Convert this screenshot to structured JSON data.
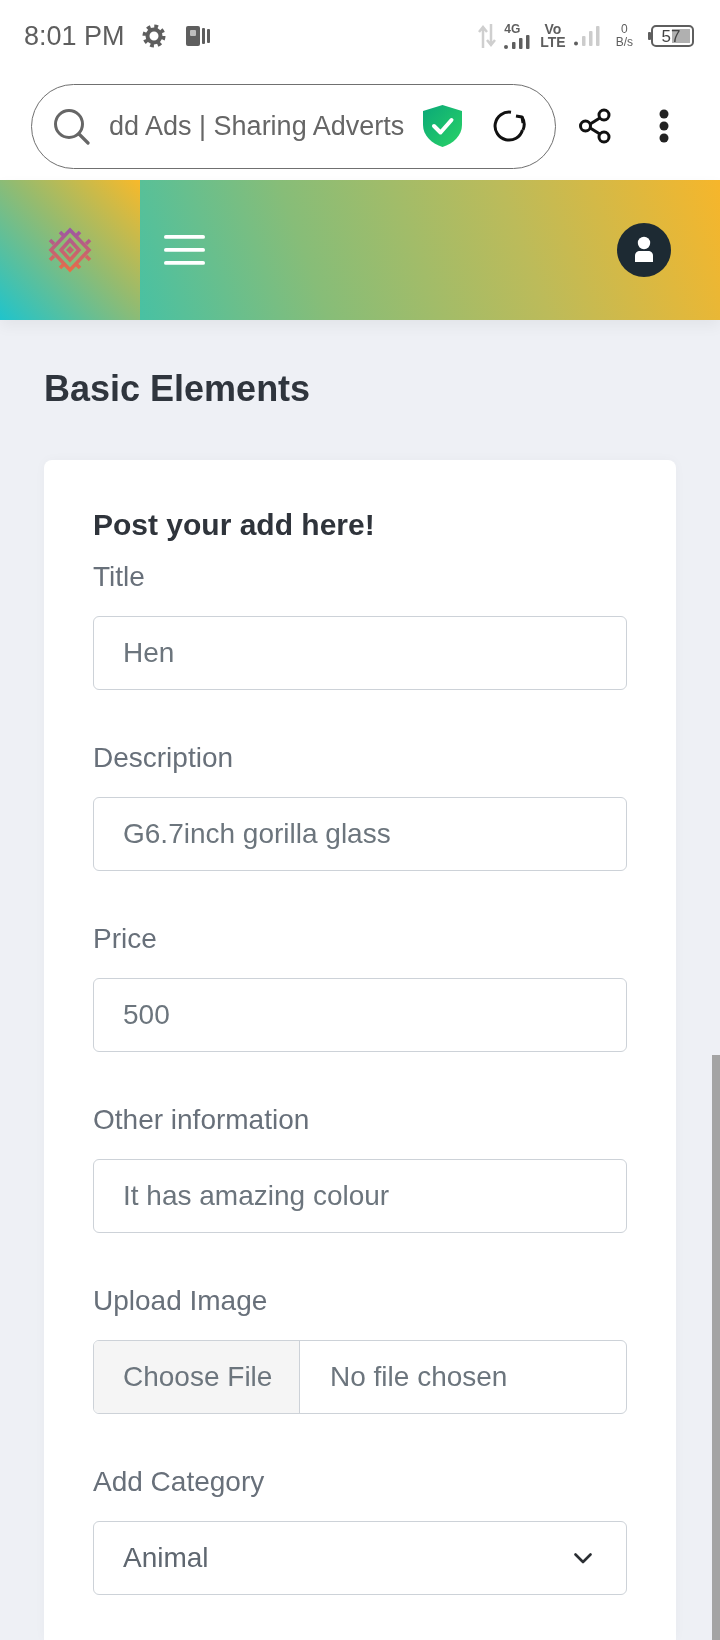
{
  "status_bar": {
    "time": "8:01 PM",
    "network_type": "4G",
    "volte": [
      "Vo",
      "LTE"
    ],
    "data_speed": {
      "value": "0",
      "unit": "B/s"
    },
    "battery": "57"
  },
  "browser": {
    "address_text": "dd Ads | Sharing Adverts"
  },
  "page": {
    "title": "Basic Elements"
  },
  "form": {
    "heading": "Post your add here!",
    "fields": [
      {
        "kind": "text",
        "label": "Title",
        "value": "Hen"
      },
      {
        "kind": "text",
        "label": "Description",
        "value": "G6.7inch gorilla glass"
      },
      {
        "kind": "text",
        "label": "Price",
        "value": "500"
      },
      {
        "kind": "text",
        "label": "Other information",
        "value": "It has amazing colour"
      },
      {
        "kind": "file",
        "label": "Upload Image",
        "button": "Choose File",
        "value": "No file chosen"
      },
      {
        "kind": "select",
        "label": "Add Category",
        "value": "Animal"
      }
    ]
  }
}
